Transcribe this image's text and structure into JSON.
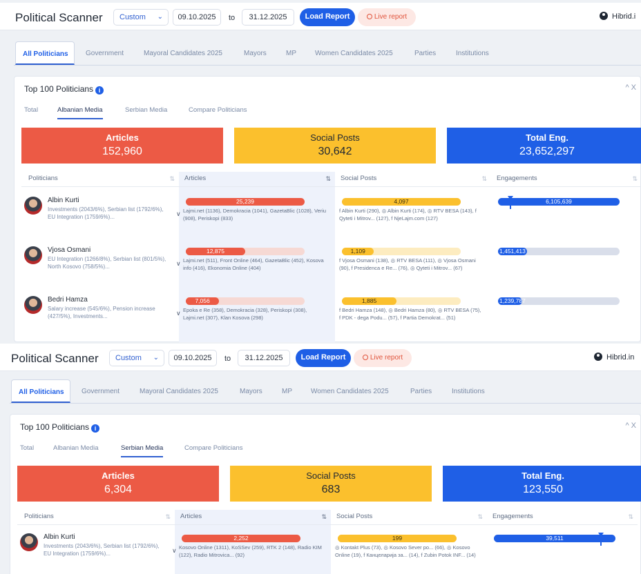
{
  "colors": {
    "articles": "#ec5a45",
    "articles_track": "#f6d9d4",
    "social": "#fbc02d",
    "social_track": "#fdecc0",
    "engagements": "#1f5fe6",
    "engagements_track": "#d9deea",
    "accent": "#1f5fe6"
  },
  "panels": [
    {
      "header": {
        "title": "Political Scanner",
        "range_select": "Custom",
        "date_from": "09.10.2025",
        "to_label": "to",
        "date_to": "31.12.2025",
        "load_button": "Load Report",
        "live_button": "Live report",
        "user": "Hibrid.i"
      },
      "nav_tabs": [
        "All Politicians",
        "Government",
        "Mayoral Candidates 2025",
        "Mayors",
        "MP",
        "Women Candidates 2025",
        "Parties",
        "Institutions"
      ],
      "active_nav": 0,
      "card": {
        "title": "Top 100 Politicians",
        "info_icon": "i",
        "controls": "^  X",
        "sub_tabs": [
          "Total",
          "Albanian Media",
          "Serbian Media",
          "Compare Politicians"
        ],
        "active_sub": 1,
        "kpis": [
          {
            "label": "Articles",
            "value": "152,960"
          },
          {
            "label": "Social Posts",
            "value": "30,642"
          },
          {
            "label": "Total Eng.",
            "value": "23,652,297"
          }
        ],
        "columns": [
          "Politicians",
          "Articles",
          "Social Posts",
          "Engagements"
        ],
        "rows": [
          {
            "name": "Albin Kurti",
            "topics": "Investments (2043/6%), Serbian list (1792/6%), EU Integration (1759/6%)...",
            "articles": {
              "value": "25,239",
              "fill": 1.0,
              "sources": "Lajmi.net (1136), Demokracia (1041), GazetaBlic (1028), Veriu (908), Periskopi (833)"
            },
            "social": {
              "value": "4,097",
              "fill": 1.0,
              "sources": "f Albin Kurti (290), ◎ Albin Kurti (174), ◎ RTV BESA (143), f Qyteti i Mitrov... (127), f NjeLajm.com (127)"
            },
            "engagements": {
              "value": "6,105,639",
              "fill": 1.0,
              "marker": 0.1
            }
          },
          {
            "name": "Vjosa Osmani",
            "topics": "EU Integration (1266/8%), Serbian list (801/5%), North Kosovo (758/5%)...",
            "articles": {
              "value": "12,875",
              "fill": 0.5,
              "sources": "Lajmi.net (511), Front Online (464), GazetaBlic (452), Kosova info (416), Ekonomia Online (404)"
            },
            "social": {
              "value": "1,109",
              "fill": 0.27,
              "sources": "f Vjosa Osmani (138), ◎ RTV BESA (111), ◎ Vjosa Osmani (90), f Presidenca e Re... (76), ◎ Qyteti i Mitrov... (67)"
            },
            "engagements": {
              "value": "1,451,413",
              "fill": 0.24
            }
          },
          {
            "name": "Bedri Hamza",
            "topics": "Salary increase (545/6%), Pension increase (427/5%), Investments...",
            "articles": {
              "value": "7,056",
              "fill": 0.28,
              "sources": "Epoka e Re (358), Demokracia (328), Periskopi (308), Lajmi.net (307), Klan Kosova (298)"
            },
            "social": {
              "value": "1,885",
              "fill": 0.46,
              "sources": "f Bedri Hamza (148), ◎ Bedri Hamza (80), ◎ RTV BESA (75), f PDK - dega Podu... (57), f Partia Demokrat... (51)"
            },
            "engagements": {
              "value": "1,239,787",
              "fill": 0.2
            }
          }
        ]
      }
    },
    {
      "header": {
        "title": "Political Scanner",
        "range_select": "Custom",
        "date_from": "09.10.2025",
        "to_label": "to",
        "date_to": "31.12.2025",
        "load_button": "Load Report",
        "live_button": "Live report",
        "user": "Hibrid.in"
      },
      "nav_tabs": [
        "All Politicians",
        "Government",
        "Mayoral Candidates 2025",
        "Mayors",
        "MP",
        "Women Candidates 2025",
        "Parties",
        "Institutions"
      ],
      "active_nav": 0,
      "card": {
        "title": "Top 100 Politicians",
        "info_icon": "i",
        "controls": "^  X",
        "sub_tabs": [
          "Total",
          "Albanian Media",
          "Serbian Media",
          "Compare Politicians"
        ],
        "active_sub": 2,
        "kpis": [
          {
            "label": "Articles",
            "value": "6,304"
          },
          {
            "label": "Social Posts",
            "value": "683"
          },
          {
            "label": "Total Eng.",
            "value": "123,550"
          }
        ],
        "columns": [
          "Politicians",
          "Articles",
          "Social Posts",
          "Engagements"
        ],
        "rows": [
          {
            "name": "Albin Kurti",
            "topics": "Investments (2043/6%), Serbian list (1792/6%), EU Integration (1759/6%)...",
            "articles": {
              "value": "2,252",
              "fill": 1.0,
              "sources": "Kosovo Online (1311), KoSSev (259), RTK 2 (148), Radio KIM (122), Radio Mitrovica... (92)"
            },
            "social": {
              "value": "199",
              "fill": 1.0,
              "sources": "◎ Kontakt Plus (73), ◎ Kosovo Sever po... (66), ◎ Kosovo Online (19), f Канцеларија за... (14), f Zubin Potok INF... (14)"
            },
            "engagements": {
              "value": "39,511",
              "fill": 1.0,
              "marker": 0.88
            }
          }
        ]
      }
    }
  ]
}
